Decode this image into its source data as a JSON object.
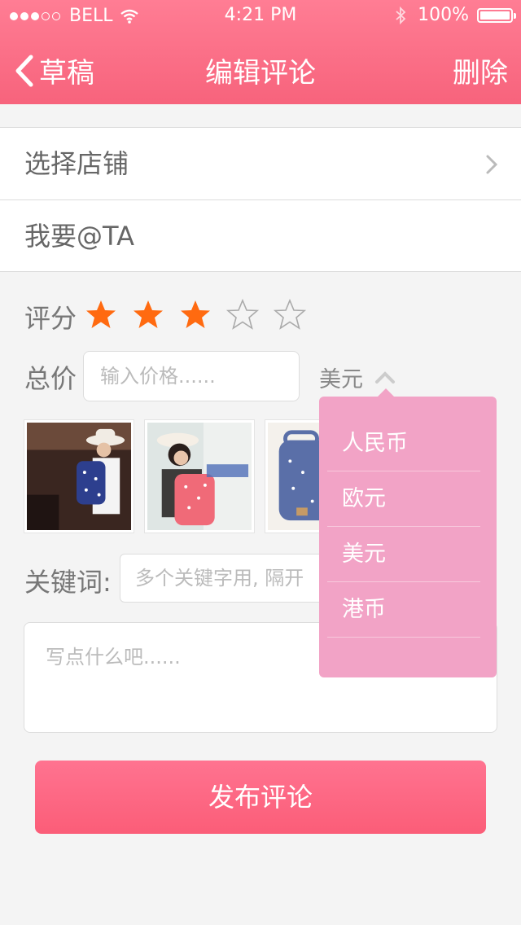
{
  "status_bar": {
    "carrier": "BELL",
    "time": "4:21 PM",
    "battery": "100%"
  },
  "nav": {
    "back_label": "草稿",
    "title": "编辑评论",
    "delete_label": "删除"
  },
  "form": {
    "store_label": "选择店铺",
    "mention_label": "我要@TA",
    "rating_label": "评分",
    "rating_value": 3,
    "rating_max": 5,
    "price_label": "总价",
    "price_placeholder": "输入价格......",
    "currency_selected": "美元",
    "keywords_label": "关键词:",
    "keywords_placeholder": "多个关键字用, 隔开",
    "comment_placeholder": "写点什么吧......"
  },
  "currency_dropdown": {
    "options": [
      "人民币",
      "欧元",
      "美元",
      "港币"
    ]
  },
  "photos": [
    {
      "icon": "backpack-photo-navy"
    },
    {
      "icon": "backpack-photo-pink"
    },
    {
      "icon": "backpack-photo-blue"
    }
  ],
  "publish_button": "发布评论",
  "colors": {
    "header": "#f7637c",
    "star": "#ff6a10",
    "dropdown": "#f2a3c6",
    "button": "#fb5d78"
  }
}
